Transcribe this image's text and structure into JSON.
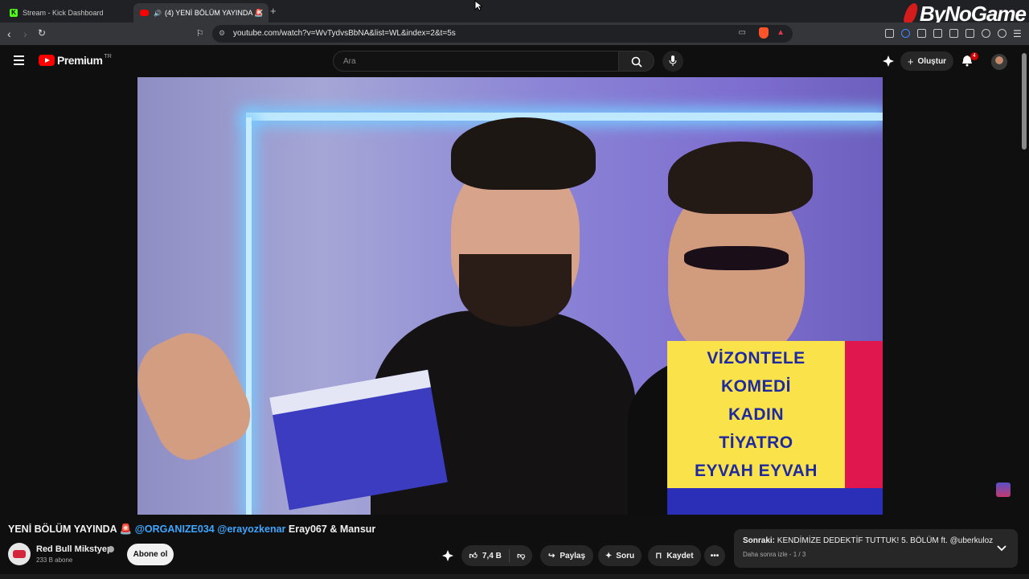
{
  "browser": {
    "tabs": [
      {
        "label": "Stream - Kick Dashboard"
      },
      {
        "label": "(4) YENİ BÖLÜM YAYINDA 🚨"
      }
    ],
    "url": "youtube.com/watch?v=WvTydvsBbNA&list=WL&index=2&t=5s",
    "brand": "ByNoGame"
  },
  "youtube": {
    "logo_text": "Premium",
    "country": "TR",
    "search_placeholder": "Ara",
    "create_label": "Oluştur",
    "notification_count": "4"
  },
  "video_overlay": {
    "lines": [
      "VİZONTELE",
      "KOMEDİ",
      "KADIN",
      "TİYATRO",
      "EYVAH EYVAH"
    ]
  },
  "video": {
    "title_prefix": "YENİ BÖLÜM YAYINDA 🚨 ",
    "mention1": "@ORGANIZE034",
    "mention2": "@erayozkenar",
    "title_suffix": " Eray067 & Mansur"
  },
  "channel": {
    "name": "Red Bull Mikstyep",
    "subscribers": "233 B abone",
    "subscribe_label": "Abone ol"
  },
  "actions": {
    "likes": "7,4 B",
    "share": "Paylaş",
    "ask": "Soru",
    "save": "Kaydet"
  },
  "up_next": {
    "label": "Sonraki:",
    "title": "KENDİMİZE DEDEKTİF TUTTUK! 5. BÖLÜM ft. @uberkuloz",
    "sub": "Daha sonra izle - 1 / 3"
  },
  "colors": {
    "accent_red": "#ff0000",
    "link_blue": "#3ea6ff",
    "overlay_yellow": "#f9e24a",
    "overlay_text": "#1e2a9e"
  }
}
